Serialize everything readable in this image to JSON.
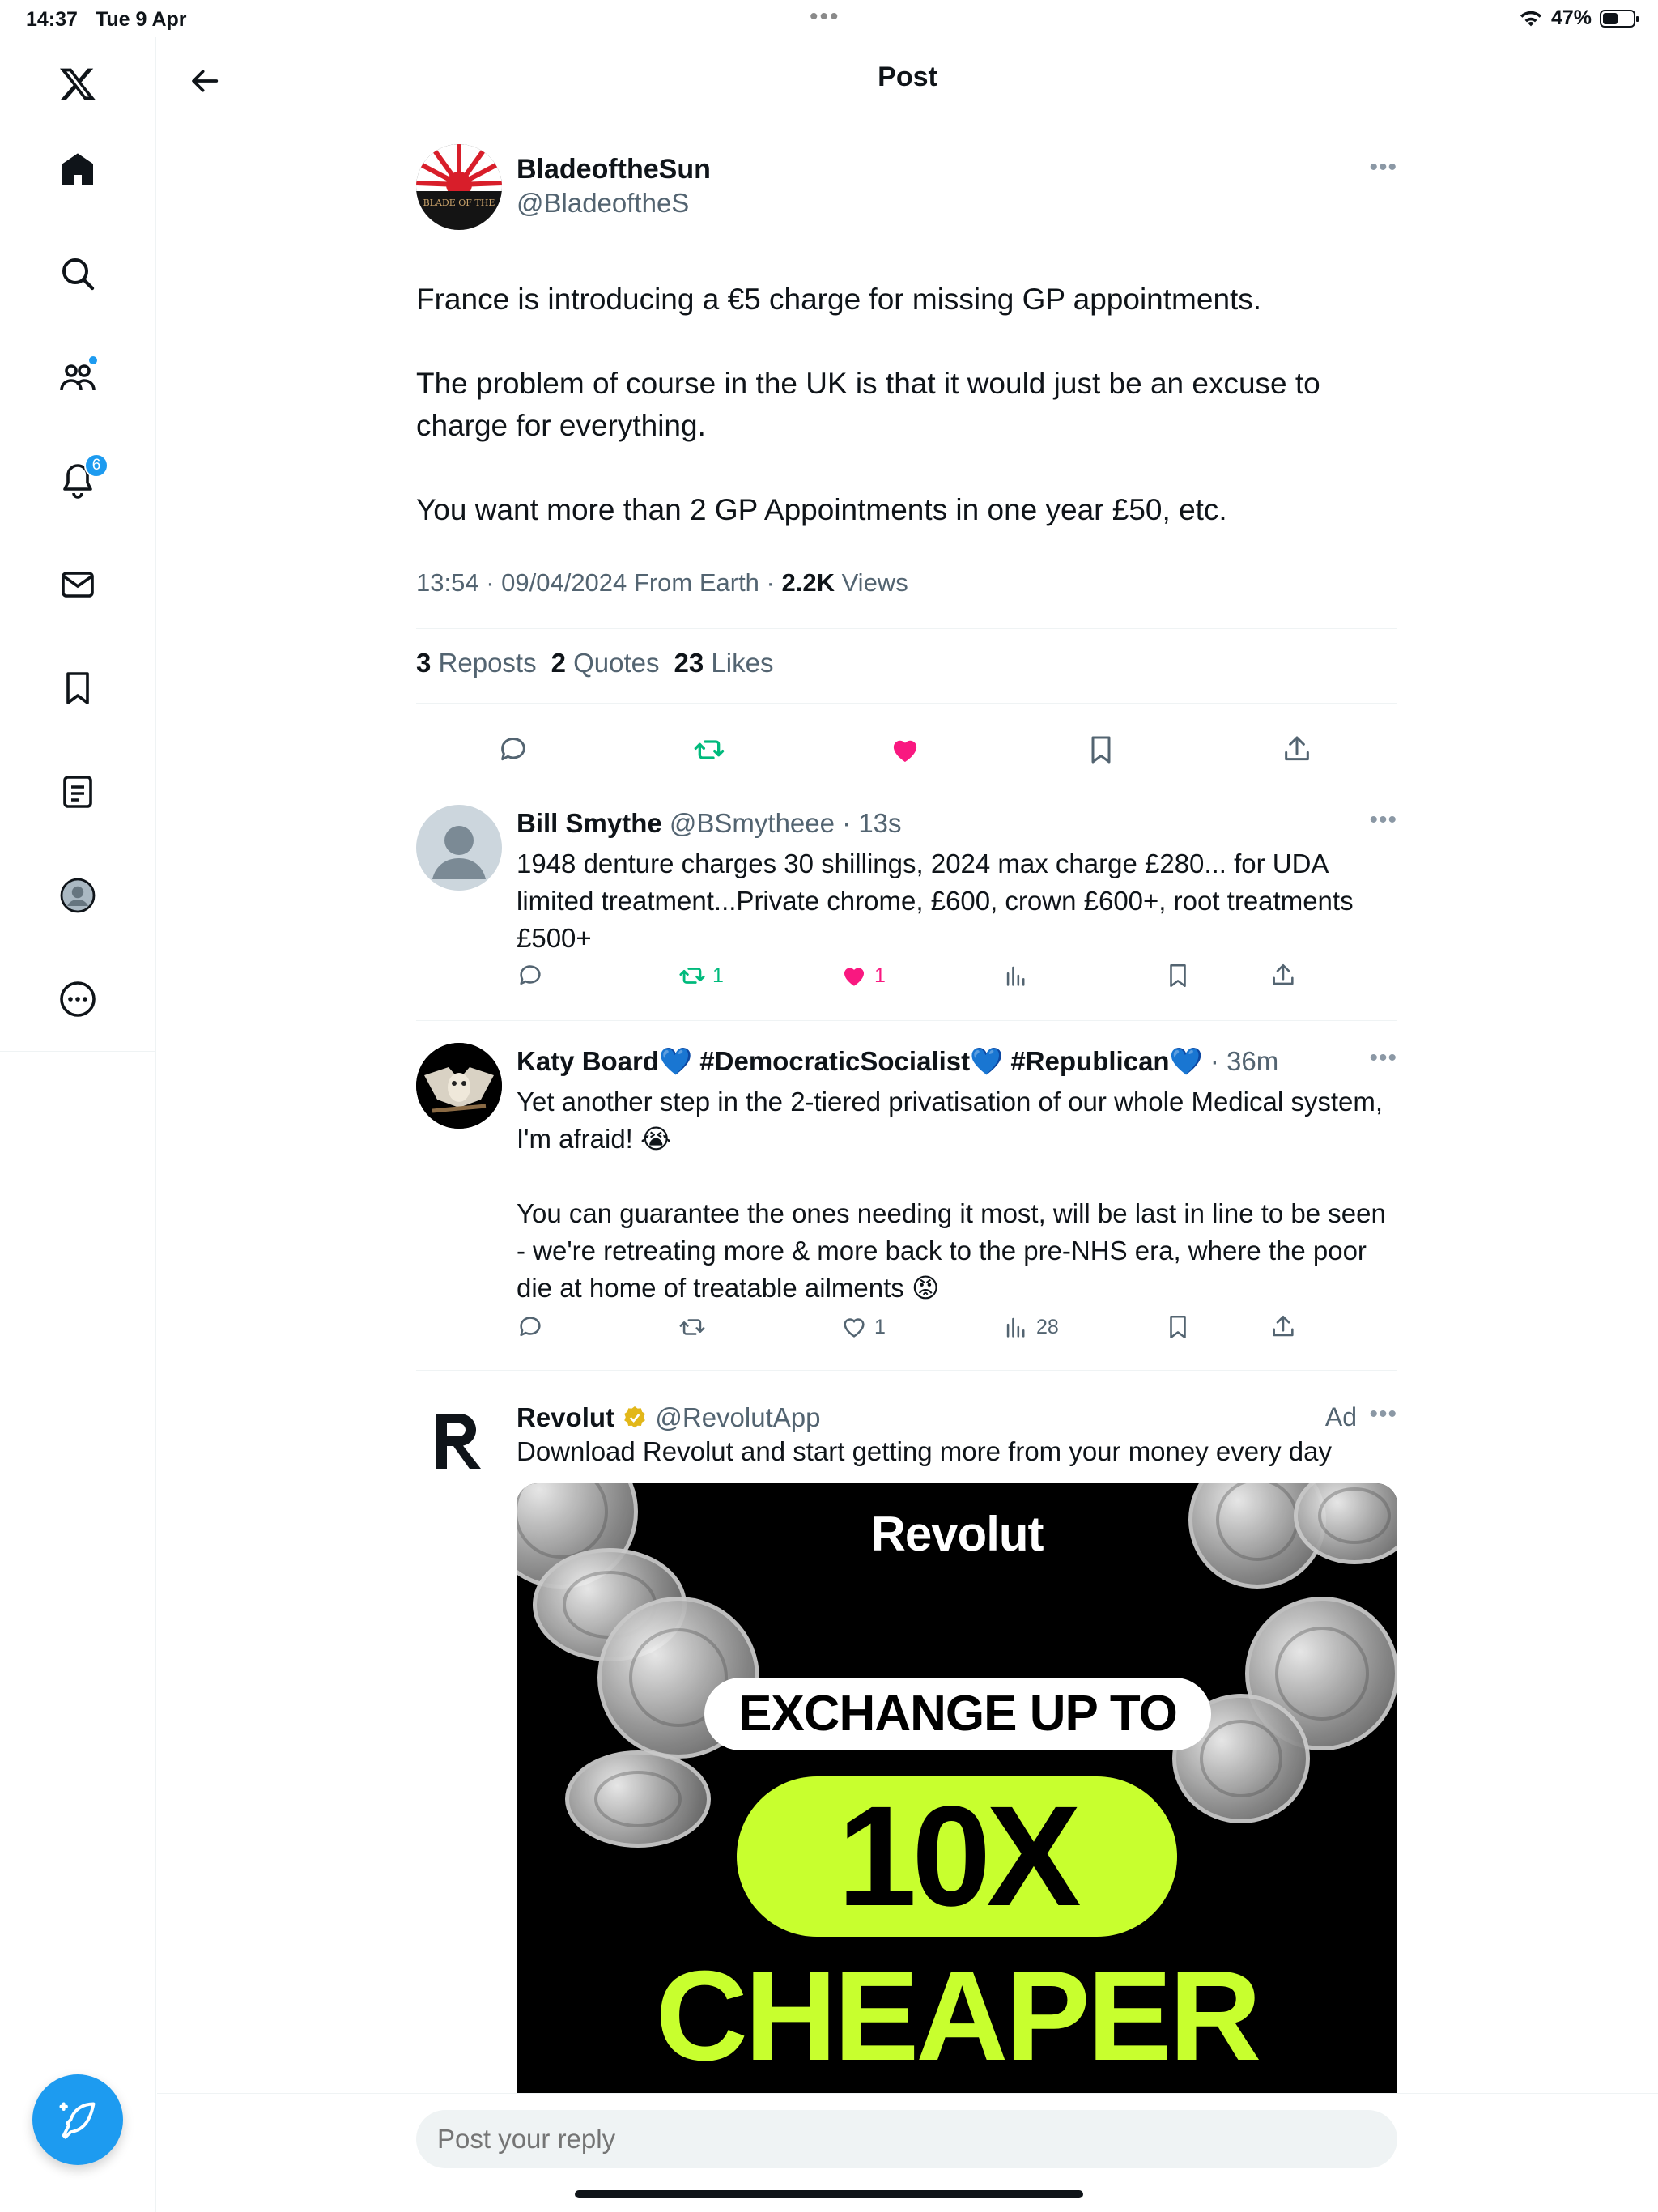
{
  "status_bar": {
    "time": "14:37",
    "date": "Tue 9 Apr",
    "battery": "47%"
  },
  "sidebar": {
    "items": [
      {
        "name": "x-logo-icon"
      },
      {
        "name": "home-icon"
      },
      {
        "name": "search-icon"
      },
      {
        "name": "communities-icon"
      },
      {
        "name": "notifications-icon",
        "badge": "6"
      },
      {
        "name": "messages-icon"
      },
      {
        "name": "bookmarks-icon"
      },
      {
        "name": "lists-icon"
      },
      {
        "name": "profile-icon"
      },
      {
        "name": "more-icon"
      }
    ],
    "compose_icon": "compose-feather-icon"
  },
  "header": {
    "title": "Post"
  },
  "main_post": {
    "name": "BladeoftheSun",
    "handle": "@BladeoftheS",
    "avatar_text": "BLADE OF THE",
    "text": "France is introducing a €5 charge for missing GP appointments.\n\nThe problem of course in the UK is that it would just be an excuse to charge for everything.\n\nYou want more than 2 GP Appointments in one year £50, etc.",
    "meta": "13:54 · 09/04/2024 From Earth · ",
    "views_count": "2.2K",
    "views_label": " Views",
    "reposts_count": "3",
    "reposts_label": "Reposts",
    "quotes_count": "2",
    "quotes_label": "Quotes",
    "likes_count": "23",
    "likes_label": "Likes"
  },
  "replies": [
    {
      "name": "Bill Smythe",
      "handle": "@BSmytheee",
      "time": "· 13s",
      "text": "1948 denture charges 30 shillings, 2024 max charge £280... for UDA limited treatment...Private chrome, £600, crown £600+, root treatments £500+",
      "reposts": "1",
      "likes": "1",
      "views": ""
    },
    {
      "name": "Katy Board💙 #DemocraticSocialist💙 #Republican💙",
      "handle": "",
      "time": "· 36m",
      "text": "Yet another step in the 2-tiered privatisation of our whole Medical system, I'm afraid! 😭\n\nYou can guarantee the ones needing it most, will be last in line to be seen - we're retreating more & more back to the pre-NHS era, where the poor die at home of treatable ailments 😡",
      "reposts": "",
      "likes": "1",
      "views": "28"
    }
  ],
  "ad": {
    "name": "Revolut",
    "handle": "@RevolutApp",
    "ad_label": "Ad",
    "text": "Download Revolut and start getting more from your money every day",
    "image_logo": "Revolut",
    "image_line1": "EXCHANGE UP TO",
    "image_line2": "10X",
    "image_line3": "CHEAPER"
  },
  "reply_bar": {
    "placeholder": "Post your reply"
  },
  "colors": {
    "accent": "#1d9bf0",
    "like": "#f91880",
    "repost": "#00ba7c",
    "ad_green": "#c8ff2e"
  }
}
